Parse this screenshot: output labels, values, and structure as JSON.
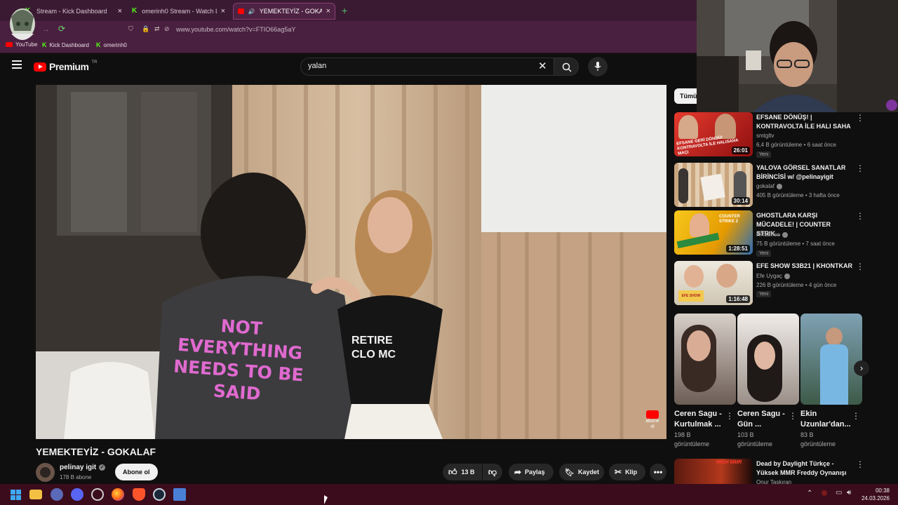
{
  "browser": {
    "tabs": [
      {
        "title": "Stream - Kick Dashboard"
      },
      {
        "title": "omerinh0 Stream - Watch Live o"
      },
      {
        "title": "YEMEKTEYİZ - GOKALAF - Y"
      }
    ],
    "url": "www.youtube.com/watch?v=FTIO66ag5aY",
    "bookmarks": [
      "YouTube",
      "Kick Dashboard",
      "omerinh0"
    ]
  },
  "youtube": {
    "logo_text": "Premium",
    "logo_badge": "TR",
    "search_value": "yalan",
    "chip_label": "Tümü"
  },
  "video": {
    "title": "YEMEKTEYİZ - GOKALAF",
    "channel": "pelinay igit",
    "subscribers": "178 B abone",
    "subscribe_label": "Abone ol",
    "like_count": "13 B",
    "share_label": "Paylaş",
    "save_label": "Kaydet",
    "clip_label": "Klip",
    "shirt_text": [
      "NOT EVERYTHING",
      "NEEDS TO BE",
      "SAID"
    ],
    "shirt2_text": [
      "RETIRE",
      "CLO MC"
    ],
    "watermark": "abone ol"
  },
  "recommendations": [
    {
      "title": "EFSANE DÖNÜŞ! | KONTRAVOLTA İLE HALI SAHA",
      "channel": "smtgltv",
      "meta": "6,4 B görüntüleme • 6 saat önce",
      "duration": "26:01",
      "badge": "Yeni",
      "thumb_text": "EFSANE GERİ DÖNDÜ! KONTRAVOLTA İLE HALISAHA MAÇI"
    },
    {
      "title": "YALOVA GÖRSEL SANATLAR BİRİNCİSİ w/ @pelinayigit",
      "channel": "gokalaf",
      "meta": "405 B görüntüleme • 3 hafta önce",
      "duration": "30:14",
      "badge": "",
      "thumb_text": ""
    },
    {
      "title": "GHOSTLARA KARŞI MÜCADELE! | COUNTER STRIK...",
      "channel": "RRaenee",
      "meta": "75 B görüntüleme • 7 saat önce",
      "duration": "1:28:51",
      "badge": "Yeni",
      "thumb_text": "COUNTER STRIKE 2"
    },
    {
      "title": "EFE SHOW S3B21 | KHONTKAR",
      "channel": "Efe Uygaç",
      "meta": "226 B görüntüleme • 4 gün önce",
      "duration": "1:16:48",
      "badge": "Yeni",
      "thumb_text": "EFE SHOW"
    }
  ],
  "shorts": [
    {
      "title": "Ceren Sagu - Kurtulmak ...",
      "views": "198 B",
      "views_label": "görüntüleme"
    },
    {
      "title": "Ceren Sagu - Gün ...",
      "views": "103 B",
      "views_label": "görüntüleme"
    },
    {
      "title": "Ekin Uzunlar'dan...",
      "views": "83 B",
      "views_label": "görüntüleme"
    }
  ],
  "bottom_rec": {
    "title": "Dead by Daylight Türkçe - Yüksek MMR Freddy Oynanışı",
    "channel": "Onur Taşkıran",
    "thumb_text": "HIGH MMR"
  },
  "taskbar": {
    "time": "00:38",
    "date": "24.03.2026"
  },
  "colors": {
    "youtube_red": "#ff0000",
    "kick_green": "#53fc18",
    "tab_bg": "#3a1a32",
    "taskbar_bg": "#3b0c1c"
  },
  "icons": [
    "menu-icon",
    "youtube-logo-icon",
    "clear-icon",
    "search-icon",
    "mic-icon",
    "like-icon",
    "dislike-icon",
    "share-icon",
    "save-icon",
    "clip-icon",
    "more-icon",
    "next-icon",
    "verified-icon",
    "windows-start-icon",
    "file-explorer-icon",
    "discord-icon",
    "firefox-icon",
    "brave-icon",
    "steam-icon"
  ]
}
